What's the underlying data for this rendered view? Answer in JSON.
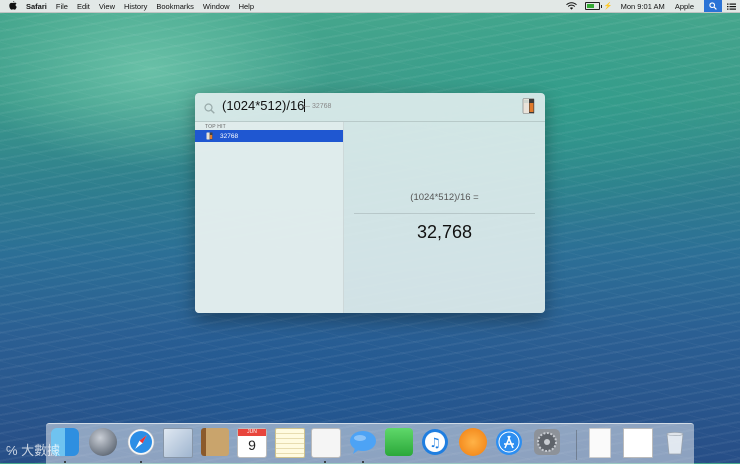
{
  "menubar": {
    "app_name": "Safari",
    "menus": [
      "File",
      "Edit",
      "View",
      "History",
      "Bookmarks",
      "Window",
      "Help"
    ],
    "clock": "Mon 9:01 AM",
    "user": "Apple",
    "battery_level": 0.6
  },
  "spotlight": {
    "query": "(1024*512)/16",
    "inline_result": "— 32768",
    "section_label": "TOP HIT",
    "top_hit_label": "32768",
    "expression": "(1024*512)/16 =",
    "answer": "32,768"
  },
  "dock": {
    "apps": [
      "finder-icon",
      "launchpad-icon",
      "safari-icon",
      "mail-icon",
      "contacts-icon",
      "calendar-icon",
      "notes-icon",
      "reminders-icon",
      "messages-icon",
      "facetime-icon",
      "itunes-icon",
      "ibooks-icon",
      "app-store-icon",
      "system-preferences-icon"
    ],
    "calendar_month": "JUN",
    "calendar_day": "9"
  },
  "watermark": "大數據",
  "colors": {
    "accent": "#1f57d1",
    "menubar": "#ececec",
    "panel": "#dcecec"
  }
}
